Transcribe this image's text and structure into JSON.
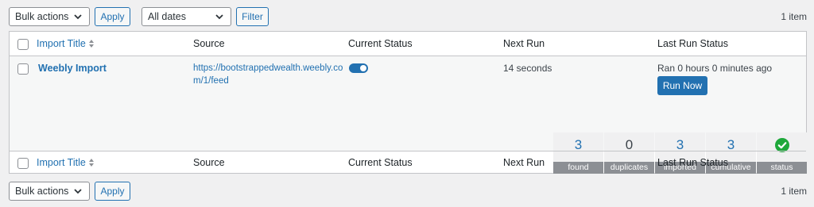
{
  "top_nav": {
    "bulk_actions": "Bulk actions",
    "apply": "Apply",
    "dates": "All dates",
    "filter": "Filter",
    "count": "1 item"
  },
  "bottom_nav": {
    "bulk_actions": "Bulk actions",
    "apply": "Apply",
    "count": "1 item"
  },
  "columns": {
    "title": "Import Title",
    "source": "Source",
    "status": "Current Status",
    "next_run": "Next Run",
    "last_run": "Last Run Status"
  },
  "row": {
    "title": "Weebly Import",
    "source": "https://bootstrappedwealth.weebly.com/1/feed",
    "toggle_on": true,
    "next_run": "14 seconds",
    "last_run": "Ran 0 hours 0 minutes ago",
    "run_now": "Run Now"
  },
  "stats": [
    {
      "value": "3",
      "label": "found"
    },
    {
      "value": "0",
      "label": "duplicates"
    },
    {
      "value": "3",
      "label": "imported"
    },
    {
      "value": "3",
      "label": "cumulative"
    },
    {
      "value": "",
      "label": "status",
      "icon": "check-circle-icon"
    }
  ],
  "colors": {
    "accent": "#2271b1",
    "status_ok": "#1ea83a"
  }
}
